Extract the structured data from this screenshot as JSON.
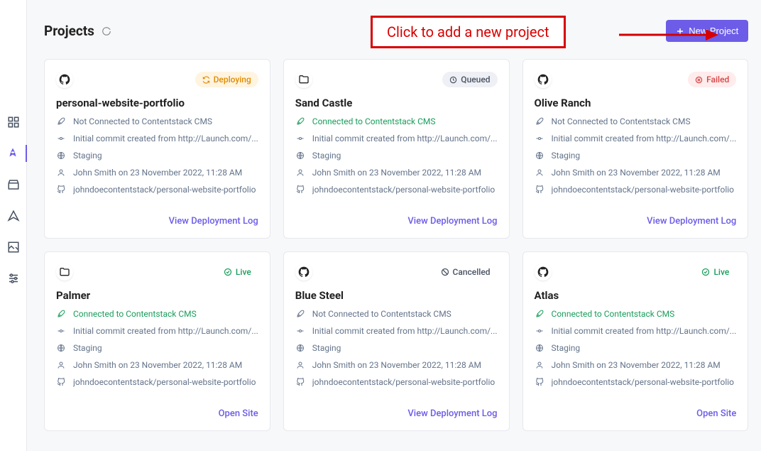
{
  "header": {
    "title": "Projects",
    "new_project_label": "New Project"
  },
  "annotation": {
    "text": "Click to add a new project"
  },
  "sidebar": {
    "items": [
      {
        "name": "apps",
        "active": false
      },
      {
        "name": "launch",
        "active": true
      },
      {
        "name": "marketplace",
        "active": false
      },
      {
        "name": "automation",
        "active": false
      },
      {
        "name": "assets",
        "active": false
      },
      {
        "name": "settings",
        "active": false
      }
    ]
  },
  "status_labels": {
    "deploying": "Deploying",
    "queued": "Queued",
    "failed": "Failed",
    "live": "Live",
    "cancelled": "Cancelled"
  },
  "connection_labels": {
    "connected": "Connected to Contentstack CMS",
    "not_connected": "Not Connected to Contentstack CMS"
  },
  "action_labels": {
    "view_log": "View Deployment Log",
    "open_site": "Open Site"
  },
  "projects": [
    {
      "source": "github",
      "status": "deploying",
      "title": "personal-website-portfolio",
      "connected": false,
      "commit": "Initial commit created from http://Launch.com/...",
      "env": "Staging",
      "author": "John Smith on 23 November 2022, 11:28 AM",
      "repo": "johndoecontentstack/personal-website-portfolio",
      "action": "view_log"
    },
    {
      "source": "file",
      "status": "queued",
      "title": "Sand Castle",
      "connected": true,
      "commit": "Initial commit created from http://Launch.com/...",
      "env": "Staging",
      "author": "John Smith on 23 November 2022, 11:28 AM",
      "repo": "johndoecontentstack/personal-website-portfolio",
      "action": "view_log"
    },
    {
      "source": "github",
      "status": "failed",
      "title": "Olive Ranch",
      "connected": false,
      "commit": "Initial commit created from http://Launch.com/...",
      "env": "Staging",
      "author": "John Smith on 23 November 2022, 11:28 AM",
      "repo": "johndoecontentstack/personal-website-portfolio",
      "action": "view_log"
    },
    {
      "source": "file",
      "status": "live",
      "title": "Palmer",
      "connected": true,
      "commit": "Initial commit created from http://Launch.com/...",
      "env": "Staging",
      "author": "John Smith on 23 November 2022, 11:28 AM",
      "repo": "johndoecontentstack/personal-website-portfolio",
      "action": "open_site"
    },
    {
      "source": "github",
      "status": "cancelled",
      "title": "Blue Steel",
      "connected": false,
      "commit": "Initial commit created from http://Launch.com/...",
      "env": "Staging",
      "author": "John Smith on 23 November 2022, 11:28 AM",
      "repo": "johndoecontentstack/personal-website-portfolio",
      "action": "view_log"
    },
    {
      "source": "github",
      "status": "live",
      "title": "Atlas",
      "connected": true,
      "commit": "Initial commit created from http://Launch.com/...",
      "env": "Staging",
      "author": "John Smith on 23 November 2022, 11:28 AM",
      "repo": "johndoecontentstack/personal-website-portfolio",
      "action": "open_site"
    }
  ]
}
